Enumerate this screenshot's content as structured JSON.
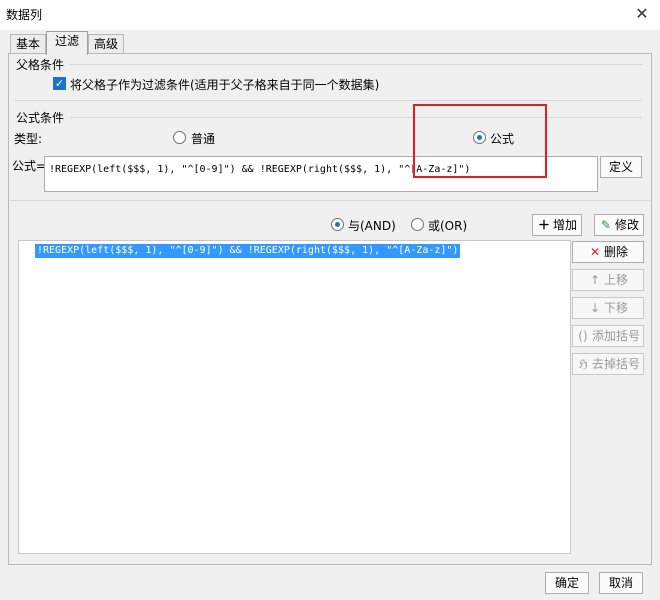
{
  "window": {
    "title": "数据列"
  },
  "tabs": [
    {
      "label": "基本"
    },
    {
      "label": "过滤"
    },
    {
      "label": "高级"
    }
  ],
  "parent_condition": {
    "section_label": "父格条件",
    "checkbox_label": "将父格子作为过滤条件(适用于父子格来自于同一个数据集)",
    "checked": true
  },
  "formula_condition": {
    "section_label": "公式条件",
    "type_label": "类型:",
    "radio_normal": "普通",
    "radio_formula": "公式",
    "selected": "公式",
    "formula_label": "公式=",
    "formula_text": "!REGEXP(left($$$, 1), \"^[0-9]\") && !REGEXP(right($$$, 1), \"^[A-Za-z]\")",
    "define_button": "定义"
  },
  "logic": {
    "and_label": "与(AND)",
    "or_label": "或(OR)",
    "selected": "与(AND)"
  },
  "actions": {
    "add": "增加",
    "modify": "修改",
    "delete": "删除",
    "move_up": "上移",
    "move_down": "下移",
    "add_paren": "添加括号",
    "remove_paren": "去掉括号"
  },
  "conditions_list": [
    {
      "text": "!REGEXP(left($$$, 1), \"^[0-9]\") && !REGEXP(right($$$, 1), \"^[A-Za-z]\")",
      "selected": true
    }
  ],
  "footer": {
    "ok": "确定",
    "cancel": "取消"
  },
  "colors": {
    "accent": "#1a73c8",
    "selection": "#3399ff",
    "highlight_box": "#e02020",
    "delete_icon": "#e02020",
    "add_icon": "#222222"
  },
  "icons": {
    "close": "close-icon",
    "add": "plus-icon",
    "modify": "edit-icon",
    "delete": "x-icon",
    "move_up": "arrow-up-icon",
    "move_down": "arrow-down-icon",
    "add_paren": "parentheses-icon",
    "remove_paren": "remove-parentheses-icon"
  }
}
